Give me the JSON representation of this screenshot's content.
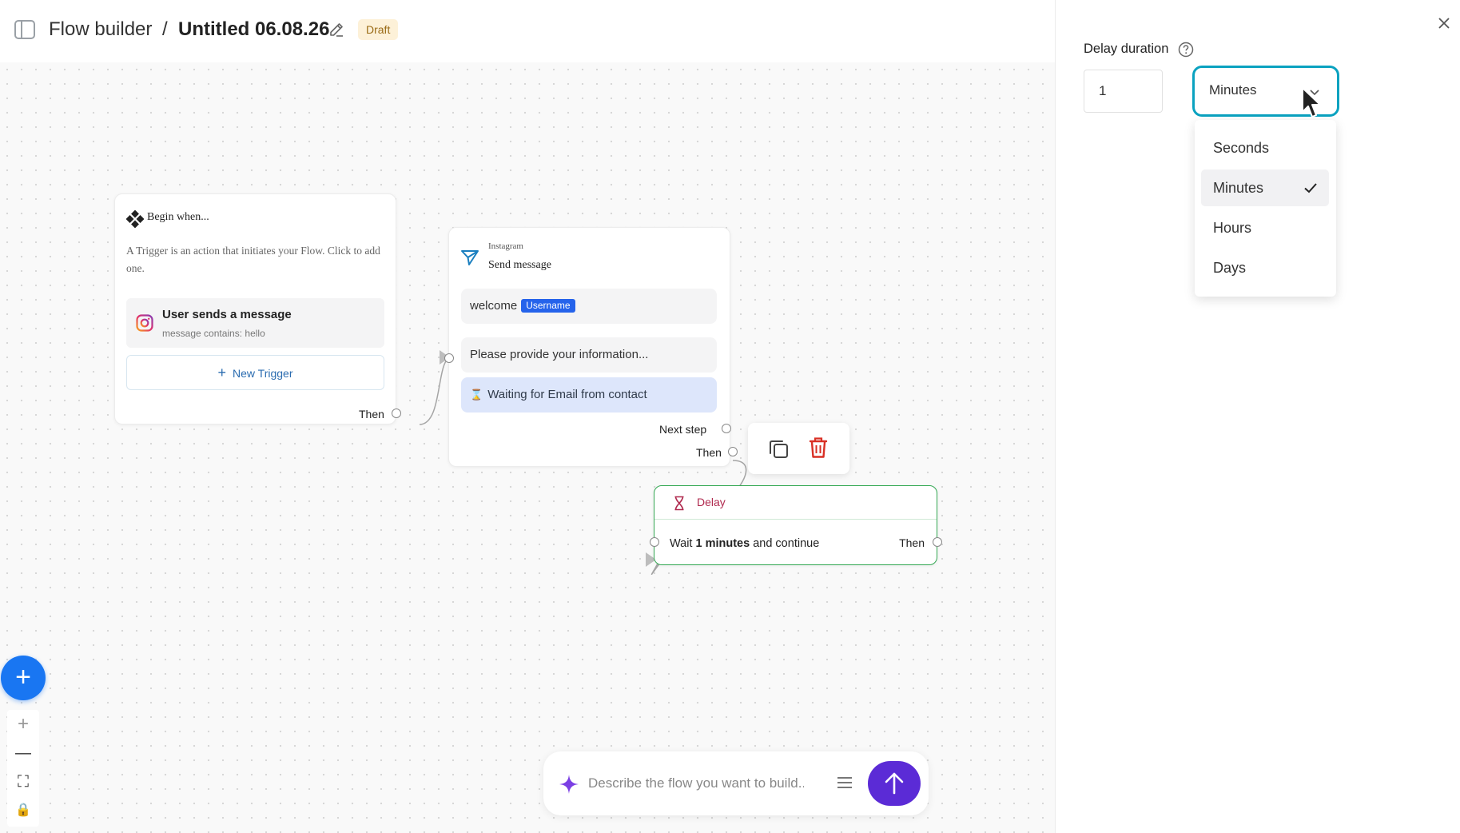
{
  "header": {
    "app_name": "Flow builder",
    "separator": "/",
    "flow_title": "Untitled 06.08.26",
    "status_badge": "Draft"
  },
  "trigger_node": {
    "title": "Begin when...",
    "description": "A Trigger is an action that initiates your Flow. Click to add one.",
    "trigger_item": {
      "label": "User sends a message",
      "sublabel": "message contains: hello",
      "icon": "instagram-icon"
    },
    "new_trigger_label": "New Trigger",
    "then_label": "Then"
  },
  "send_node": {
    "platform": "Instagram",
    "title": "Send message",
    "message_text": "welcome",
    "message_tag": "Username",
    "prompt_text": "Please provide your information...",
    "waiting_text": "Waiting for Email from contact",
    "next_step_label": "Next step",
    "then_label": "Then"
  },
  "node_toolbar": {
    "copy_icon": "copy-icon",
    "delete_icon": "trash-icon"
  },
  "delay_node": {
    "title": "Delay",
    "text_prefix": "Wait ",
    "text_bold": "1 minutes",
    "text_suffix": " and continue",
    "then_label": "Then"
  },
  "canvas_controls": {
    "add_label": "+",
    "zoom_in": "+",
    "zoom_out": "—",
    "fit_view": "⛶",
    "lock": "🔒"
  },
  "prompt": {
    "placeholder": "Describe the flow you want to build..."
  },
  "panel": {
    "label": "Delay duration",
    "duration_value": "1",
    "selected_unit": "Minutes",
    "options": [
      "Seconds",
      "Minutes",
      "Hours",
      "Days"
    ]
  },
  "colors": {
    "accent": "#0aa2c0",
    "primary_blue": "#1976f2",
    "send_purple": "#5b2bd6",
    "delay_border": "#34a853",
    "delete_red": "#d93025",
    "draft_bg": "#fdf1d8"
  }
}
